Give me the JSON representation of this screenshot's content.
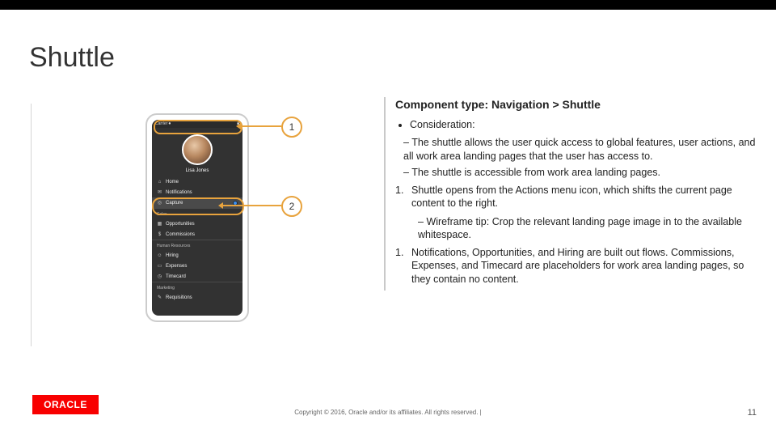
{
  "title": "Shuttle",
  "callouts": {
    "c1": "1",
    "c2": "2"
  },
  "content": {
    "heading": "Component type: Navigation > Shuttle",
    "consideration_label": "Consideration:",
    "cons1": "The shuttle allows the user quick access to global features, user actions, and all work area landing pages that the user has access to.",
    "cons2": "The shuttle is accessible from work area landing pages.",
    "step1": "Shuttle opens from the Actions menu icon, which shifts the current page content to the right.",
    "tip1": "Wireframe tip: Crop the relevant landing page image in to the available whitespace.",
    "step2": "Notifications, Opportunities, and Hiring are built out flows. Commissions, Expenses, and Timecard are placeholders for work area landing pages, so they contain no content."
  },
  "mockup": {
    "status_left": "Carrier ⏺",
    "status_right": "■",
    "profile_name": "Lisa Jones",
    "items_top": [
      {
        "icon": "⌂",
        "label": "Home"
      },
      {
        "icon": "✉",
        "label": "Notifications"
      },
      {
        "icon": "◎",
        "label": "Capture",
        "active": true,
        "toggle": true
      }
    ],
    "section_sales": "Sales",
    "items_sales": [
      {
        "icon": "▦",
        "label": "Opportunities"
      },
      {
        "icon": "$",
        "label": "Commissions"
      }
    ],
    "section_hr": "Human Resources",
    "items_hr": [
      {
        "icon": "☺",
        "label": "Hiring"
      },
      {
        "icon": "▭",
        "label": "Expenses"
      },
      {
        "icon": "◷",
        "label": "Timecard"
      }
    ],
    "section_mkt": "Marketing",
    "items_mkt": [
      {
        "icon": "✎",
        "label": "Requisitions"
      }
    ]
  },
  "footer": {
    "logo": "ORACLE",
    "copyright": "Copyright © 2016, Oracle and/or its affiliates. All rights reserved.   |",
    "page": "11"
  }
}
